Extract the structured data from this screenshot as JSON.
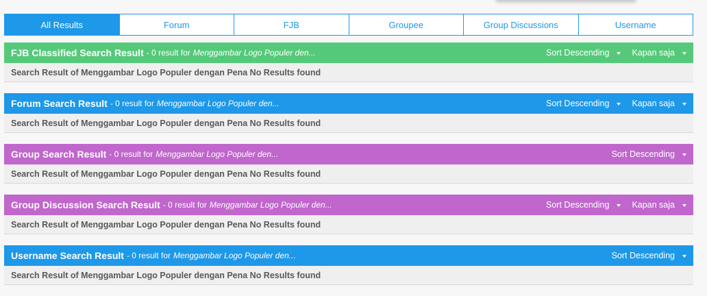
{
  "tabs": [
    {
      "label": "All Results",
      "active": true
    },
    {
      "label": "Forum",
      "active": false
    },
    {
      "label": "FJB",
      "active": false
    },
    {
      "label": "Groupee",
      "active": false
    },
    {
      "label": "Group Discussions",
      "active": false
    },
    {
      "label": "Username",
      "active": false
    }
  ],
  "colors": {
    "fjb": "#55c97a",
    "forum": "#1e98e8",
    "group": "#c066cc",
    "group_discussion": "#c066cc",
    "username": "#1e98e8"
  },
  "sections": {
    "fjb": {
      "title": "FJB Classified Search Result",
      "count": "- 0 result for",
      "query": "Menggambar Logo Populer den...",
      "sort": "Sort Descending",
      "time": "Kapan saja",
      "body": "Search Result of Menggambar Logo Populer dengan Pena No Results found"
    },
    "forum": {
      "title": "Forum Search Result",
      "count": "- 0 result for",
      "query": "Menggambar Logo Populer den...",
      "sort": "Sort Descending",
      "time": "Kapan saja",
      "body": "Search Result of Menggambar Logo Populer dengan Pena No Results found"
    },
    "group": {
      "title": "Group Search Result",
      "count": "- 0 result for",
      "query": "Menggambar Logo Populer den...",
      "sort": "Sort Descending",
      "body": "Search Result of Menggambar Logo Populer dengan Pena No Results found"
    },
    "group_discussion": {
      "title": "Group Discussion Search Result",
      "count": "- 0 result for",
      "query": "Menggambar Logo Populer den...",
      "sort": "Sort Descending",
      "time": "Kapan saja",
      "body": "Search Result of Menggambar Logo Populer dengan Pena No Results found"
    },
    "username": {
      "title": "Username Search Result",
      "count": "- 0 result for",
      "query": "Menggambar Logo Populer den...",
      "sort": "Sort Descending",
      "body": "Search Result of Menggambar Logo Populer dengan Pena No Results found"
    }
  }
}
